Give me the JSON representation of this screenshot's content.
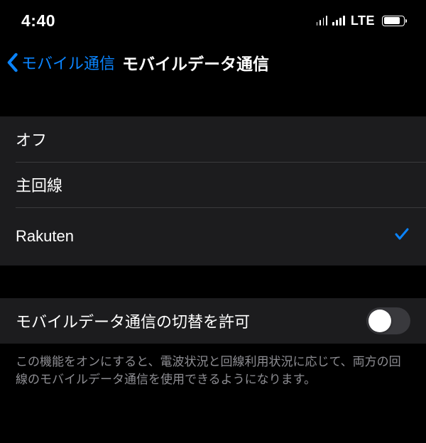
{
  "status_bar": {
    "time": "4:40",
    "network_label": "LTE"
  },
  "nav": {
    "back_label": "モバイル通信",
    "title": "モバイルデータ通信"
  },
  "options": [
    {
      "label": "オフ",
      "selected": false
    },
    {
      "label": "主回線",
      "selected": false
    },
    {
      "label": "Rakuten",
      "selected": true
    }
  ],
  "toggle": {
    "label": "モバイルデータ通信の切替を許可",
    "on": false
  },
  "footer": "この機能をオンにすると、電波状況と回線利用状況に応じて、両方の回線のモバイルデータ通信を使用できるようになります。"
}
